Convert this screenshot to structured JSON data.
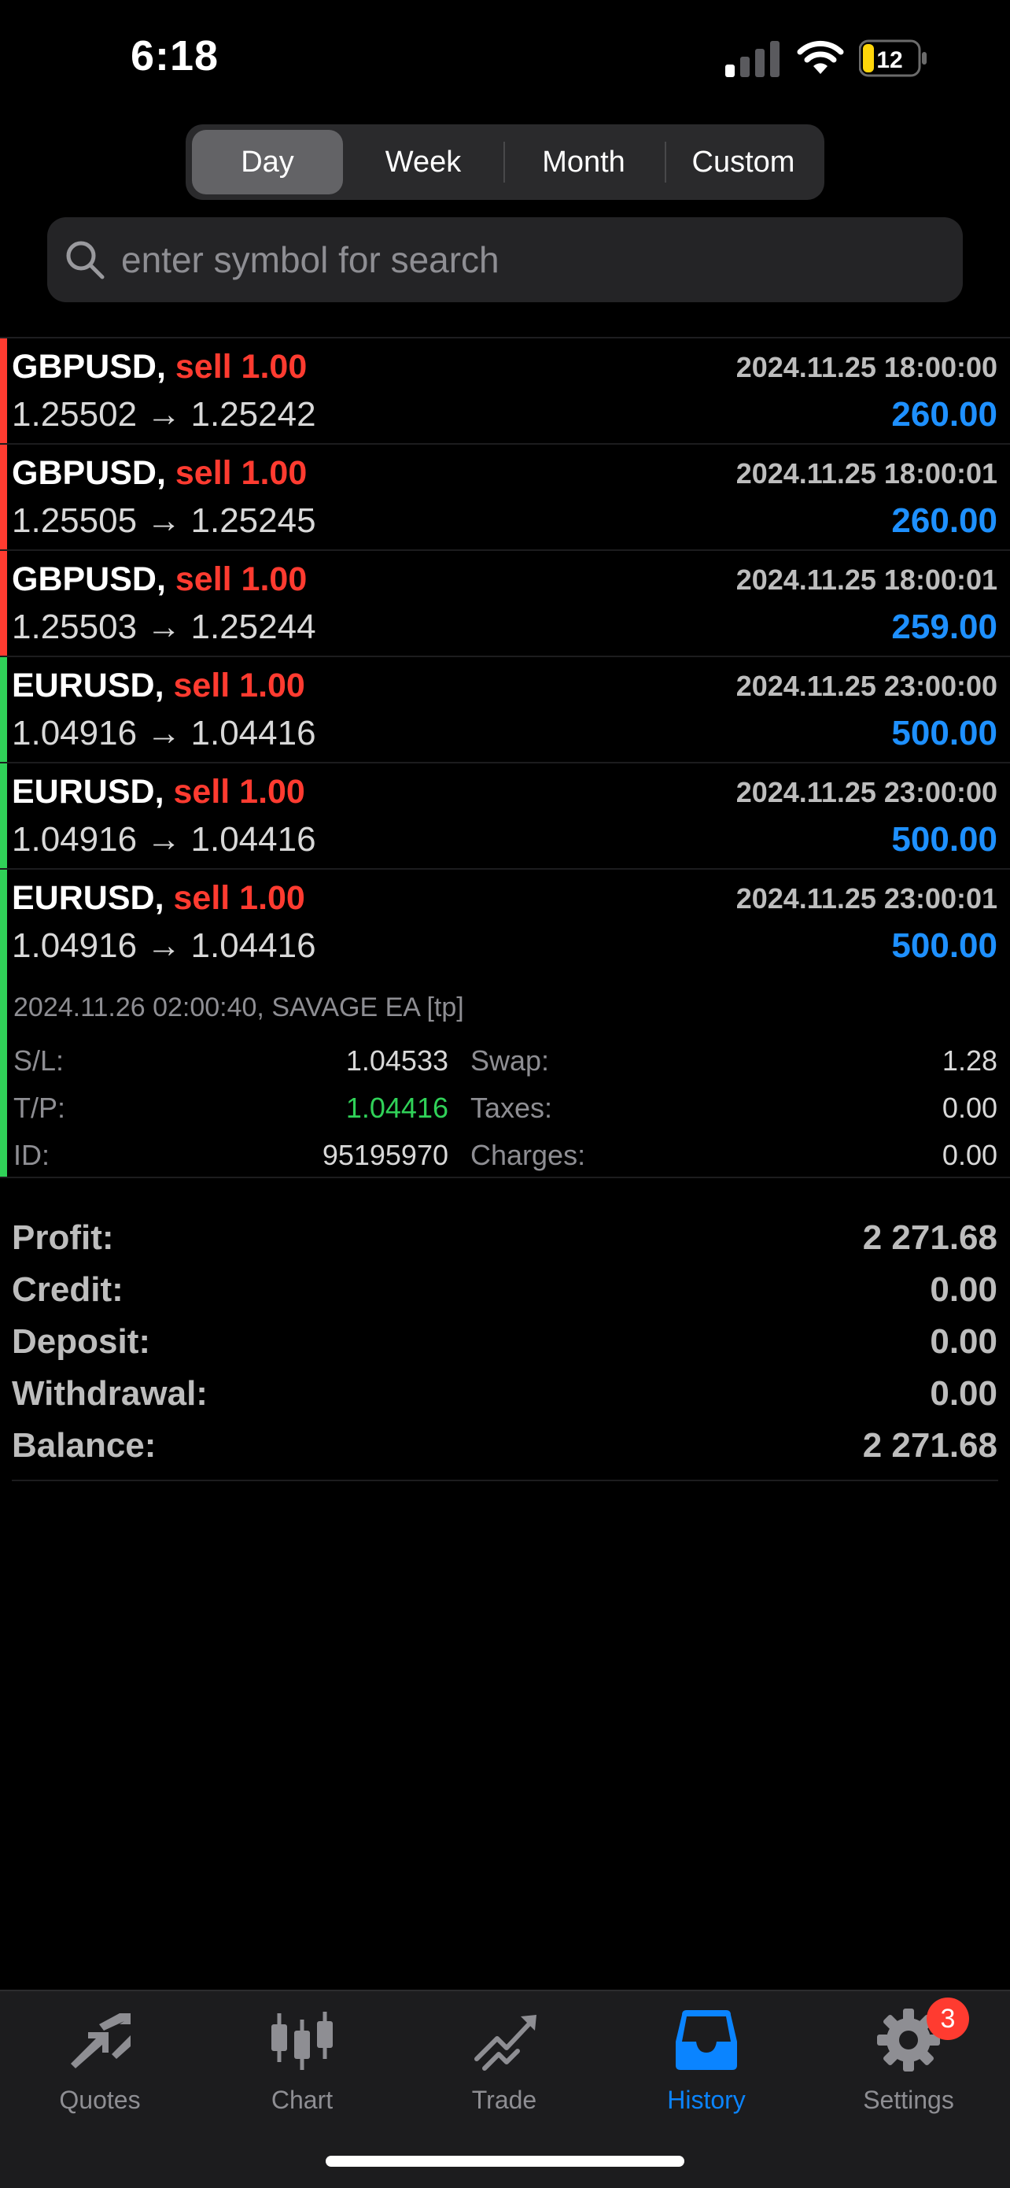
{
  "status": {
    "time": "6:18",
    "battery": "12"
  },
  "periods": [
    "Day",
    "Week",
    "Month",
    "Custom"
  ],
  "search": {
    "placeholder": "enter symbol for search"
  },
  "deals": [
    {
      "symbol": "GBPUSD,",
      "side": "sell 1.00",
      "time": "2024.11.25 18:00:00",
      "prices": "1.25502 → 1.25242",
      "profit": "260.00",
      "color": "#ff3b30"
    },
    {
      "symbol": "GBPUSD,",
      "side": "sell 1.00",
      "time": "2024.11.25 18:00:01",
      "prices": "1.25505 → 1.25245",
      "profit": "260.00",
      "color": "#ff3b30"
    },
    {
      "symbol": "GBPUSD,",
      "side": "sell 1.00",
      "time": "2024.11.25 18:00:01",
      "prices": "1.25503 → 1.25244",
      "profit": "259.00",
      "color": "#ff3b30"
    },
    {
      "symbol": "EURUSD,",
      "side": "sell 1.00",
      "time": "2024.11.25 23:00:00",
      "prices": "1.04916 → 1.04416",
      "profit": "500.00",
      "color": "#30d158"
    },
    {
      "symbol": "EURUSD,",
      "side": "sell 1.00",
      "time": "2024.11.25 23:00:00",
      "prices": "1.04916 → 1.04416",
      "profit": "500.00",
      "color": "#30d158"
    },
    {
      "symbol": "EURUSD,",
      "side": "sell 1.00",
      "time": "2024.11.25 23:00:01",
      "prices": "1.04916 → 1.04416",
      "profit": "500.00",
      "color": "#30d158"
    }
  ],
  "expanded": {
    "comment": "2024.11.26 02:00:40, SAVAGE EA [tp]",
    "sl_label": "S/L:",
    "sl": "1.04533",
    "tp_label": "T/P:",
    "tp": "1.04416",
    "id_label": "ID:",
    "id": "95195970",
    "swap_label": "Swap:",
    "swap": "1.28",
    "taxes_label": "Taxes:",
    "taxes": "0.00",
    "charges_label": "Charges:",
    "charges": "0.00"
  },
  "summary": [
    {
      "label": "Profit:",
      "value": "2 271.68"
    },
    {
      "label": "Credit:",
      "value": "0.00"
    },
    {
      "label": "Deposit:",
      "value": "0.00"
    },
    {
      "label": "Withdrawal:",
      "value": "0.00"
    },
    {
      "label": "Balance:",
      "value": "2 271.68"
    }
  ],
  "tabs": [
    {
      "label": "Quotes",
      "icon": "quotes-icon"
    },
    {
      "label": "Chart",
      "icon": "chart-icon"
    },
    {
      "label": "Trade",
      "icon": "trade-icon"
    },
    {
      "label": "History",
      "icon": "history-icon"
    },
    {
      "label": "Settings",
      "icon": "settings-icon"
    }
  ],
  "settings_badge": "3",
  "colors": {
    "accent": "#0a84ff",
    "sell": "#ff3b30",
    "profit": "#1e90ff",
    "tp": "#30d158"
  }
}
